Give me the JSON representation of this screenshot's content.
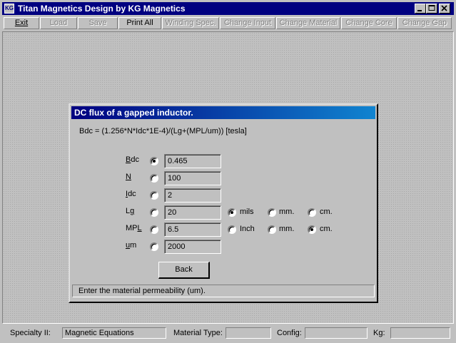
{
  "window": {
    "title": "Titan Magnetics Design by KG Magnetics",
    "app_icon_text": "KG"
  },
  "menu": [
    {
      "label": "Exit",
      "enabled": true
    },
    {
      "label": "Load",
      "enabled": false
    },
    {
      "label": "Save",
      "enabled": false
    },
    {
      "label": "Print All",
      "enabled": true
    },
    {
      "label": "Winding Spec.",
      "enabled": false
    },
    {
      "label": "Change Input",
      "enabled": false
    },
    {
      "label": "Change Material",
      "enabled": false
    },
    {
      "label": "Change Core",
      "enabled": false
    },
    {
      "label": "Change Gap",
      "enabled": false
    }
  ],
  "dialog": {
    "title": "DC flux of a gapped inductor.",
    "formula": "Bdc = (1.256*N*Idc*1E-4)/(Lg+(MPL/um))  [tesla]",
    "fields": [
      {
        "label": "Bdc",
        "value": "0.465",
        "selected": true
      },
      {
        "label": "N",
        "value": "100",
        "selected": false
      },
      {
        "label": "Idc",
        "value": "2",
        "selected": false
      },
      {
        "label": "Lg",
        "value": "20",
        "selected": false
      },
      {
        "label": "MPL",
        "value": "6.5",
        "selected": false
      },
      {
        "label": "um",
        "value": "2000",
        "selected": false
      }
    ],
    "lg_units": [
      {
        "label": "mils",
        "selected": true
      },
      {
        "label": "mm.",
        "selected": false
      },
      {
        "label": "cm.",
        "selected": false
      }
    ],
    "mpl_units": [
      {
        "label": "Inch",
        "selected": false
      },
      {
        "label": "mm.",
        "selected": false
      },
      {
        "label": "cm.",
        "selected": true
      }
    ],
    "back_label": "Back",
    "status": "Enter the material permeability  (um)."
  },
  "statusbar": {
    "specialty_label": "Specialty II:",
    "specialty_value": "Magnetic Equations",
    "material_label": "Material Type:",
    "material_value": "",
    "config_label": "Config:",
    "config_value": "",
    "kg_label": "Kg:",
    "kg_value": ""
  }
}
